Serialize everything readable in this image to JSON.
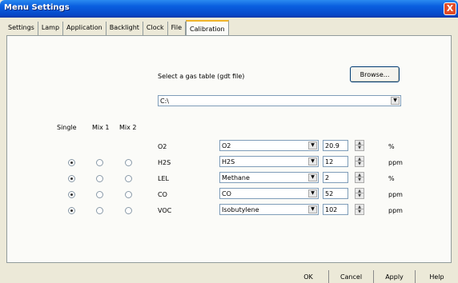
{
  "window": {
    "title": "Menu Settings",
    "close_glyph": "X"
  },
  "tabs": [
    "Settings",
    "Lamp",
    "Application",
    "Backlight",
    "Clock",
    "File",
    "Calibration"
  ],
  "active_tab": "Calibration",
  "gas_table": {
    "label": "Select a gas table (gdt file)",
    "browse_label": "Browse...",
    "path": "C:\\"
  },
  "columns": {
    "single": "Single",
    "mix1": "Mix 1",
    "mix2": "Mix 2"
  },
  "rows": [
    {
      "sensor": "O2",
      "gas": "O2",
      "value": "20.9",
      "unit": "%",
      "show_radios": false
    },
    {
      "sensor": "H2S",
      "gas": "H2S",
      "value": "12",
      "unit": "ppm",
      "show_radios": true,
      "selected": "single"
    },
    {
      "sensor": "LEL",
      "gas": "Methane",
      "value": "2",
      "unit": "%",
      "show_radios": true,
      "selected": "single"
    },
    {
      "sensor": "CO",
      "gas": "CO",
      "value": "52",
      "unit": "ppm",
      "show_radios": true,
      "selected": "single"
    },
    {
      "sensor": "VOC",
      "gas": "Isobutylene",
      "value": "102",
      "unit": "ppm",
      "show_radios": true,
      "selected": "single"
    }
  ],
  "footer": {
    "ok": "OK",
    "cancel": "Cancel",
    "apply": "Apply",
    "help": "Help"
  }
}
